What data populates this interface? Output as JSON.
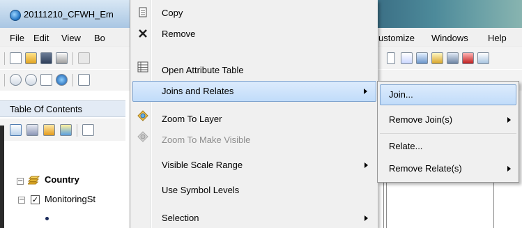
{
  "window": {
    "title": "20111210_CFWH_Em"
  },
  "menubar": {
    "items": [
      "File",
      "Edit",
      "View",
      "Bo",
      "ustomize",
      "Windows",
      "Help"
    ]
  },
  "toc": {
    "header": "Table Of Contents",
    "root_layer": "Country",
    "child_layer": "MonitoringSt"
  },
  "context_menu": {
    "items": [
      {
        "label": "Copy",
        "icon": "copy-icon"
      },
      {
        "label": "Remove",
        "icon": "remove-x-icon"
      },
      {
        "label": "Open Attribute Table",
        "icon": "table-icon"
      },
      {
        "label": "Joins and Relates",
        "has_submenu": true,
        "highlighted": true
      },
      {
        "label": "Zoom To Layer",
        "icon": "zoom-to-layer-icon"
      },
      {
        "label": "Zoom To Make Visible",
        "icon": "zoom-visible-icon",
        "disabled": true
      },
      {
        "label": "Visible Scale Range",
        "has_submenu": true
      },
      {
        "label": "Use Symbol Levels"
      },
      {
        "label": "Selection",
        "has_submenu": true
      }
    ]
  },
  "submenu": {
    "items": [
      {
        "label": "Join...",
        "highlighted": true
      },
      {
        "label": "Remove Join(s)",
        "has_submenu": true
      },
      {
        "label": "Relate..."
      },
      {
        "label": "Remove Relate(s)",
        "has_submenu": true
      }
    ]
  },
  "colors": {
    "highlight_start": "#dcebfc",
    "highlight_end": "#c1dcfa",
    "highlight_border": "#7da2ce",
    "menu_bg": "#f0f0f0"
  }
}
